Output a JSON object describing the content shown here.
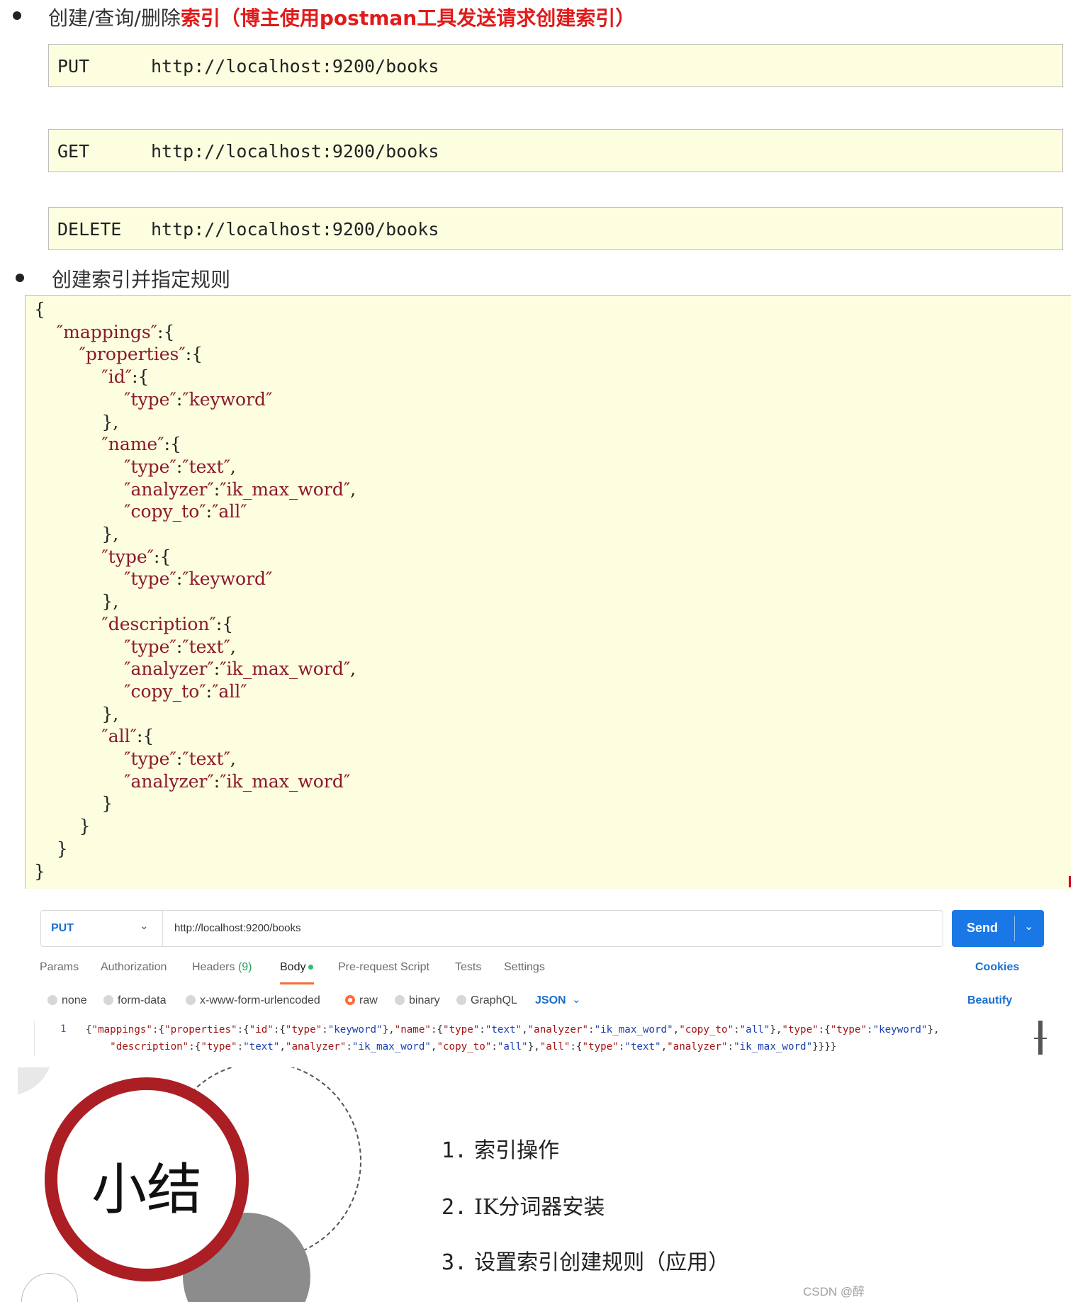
{
  "section1": {
    "heading_plain": "创建/查询/删除",
    "heading_red": "索引（博主使用postman工具发送请求创建索引）"
  },
  "requests": [
    {
      "method": "PUT",
      "url": "http://localhost:9200/books"
    },
    {
      "method": "GET",
      "url": "http://localhost:9200/books"
    },
    {
      "method": "DELETE",
      "url": "http://localhost:9200/books"
    }
  ],
  "section2": {
    "heading": "创建索引并指定规则"
  },
  "postman": {
    "method": "PUT",
    "url": "http://localhost:9200/books",
    "send_label": "Send",
    "tabs": {
      "params": "Params",
      "authorization": "Authorization",
      "headers": "Headers",
      "headers_count": "(9)",
      "body": "Body",
      "pre_request": "Pre-request Script",
      "tests": "Tests",
      "settings": "Settings"
    },
    "cookies_label": "Cookies",
    "body_types": {
      "none": "none",
      "form_data": "form-data",
      "urlencoded": "x-www-form-urlencoded",
      "raw": "raw",
      "binary": "binary",
      "graphql": "GraphQL"
    },
    "format": "JSON",
    "beautify_label": "Beautify",
    "line_number": "1"
  },
  "summary": {
    "title": "小结",
    "items": [
      {
        "num": "1.",
        "text": "索引操作"
      },
      {
        "num": "2.",
        "text": "IK分词器安装"
      },
      {
        "num": "3.",
        "text": "设置索引创建规则（应用）"
      }
    ],
    "watermark": "CSDN @醉"
  },
  "colors": {
    "highlight_red": "#e01b1b",
    "code_background": "#fdfde0",
    "postman_blue": "#1978e5",
    "postman_orange": "#ff6c37",
    "summary_ring": "#ab1f24"
  }
}
